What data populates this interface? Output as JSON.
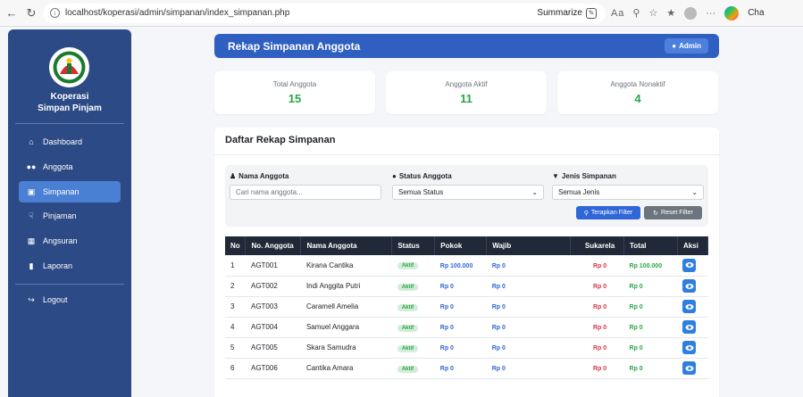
{
  "browser": {
    "url": "localhost/koperasi/admin/simpanan/index_simpanan.php",
    "summarize_label": "Summarize",
    "copilot_label": "Cha"
  },
  "sidebar": {
    "brand_line1": "Koperasi",
    "brand_line2": "Simpan Pinjam",
    "items": [
      {
        "label": "Dashboard",
        "icon": "home-icon"
      },
      {
        "label": "Anggota",
        "icon": "users-icon"
      },
      {
        "label": "Simpanan",
        "icon": "wallet-icon"
      },
      {
        "label": "Pinjaman",
        "icon": "hand-money-icon"
      },
      {
        "label": "Angsuran",
        "icon": "calendar-icon"
      },
      {
        "label": "Laporan",
        "icon": "file-icon"
      }
    ],
    "logout_label": "Logout",
    "active_item": "Simpanan"
  },
  "header": {
    "title": "Rekap Simpanan Anggota",
    "admin_label": "Admin"
  },
  "stats": [
    {
      "label": "Total Anggota",
      "value": "15"
    },
    {
      "label": "Anggota Aktif",
      "value": "11"
    },
    {
      "label": "Anggota Nonaktif",
      "value": "4"
    }
  ],
  "main": {
    "title": "Daftar Rekap Simpanan",
    "filter": {
      "name_label": "Nama Anggota",
      "name_placeholder": "Cari nama anggota...",
      "status_label": "Status Anggota",
      "status_value": "Semua Status",
      "type_label": "Jenis Simpanan",
      "type_value": "Semua Jenis",
      "apply_label": "Terapkan Filter",
      "reset_label": "Reset Filter"
    },
    "table": {
      "headers": [
        "No",
        "No. Anggota",
        "Nama Anggota",
        "Status",
        "Pokok",
        "Wajib",
        "Sukarela",
        "Total",
        "Aksi"
      ],
      "rows": [
        {
          "no": "1",
          "id": "AGT001",
          "name": "Kirana Cantika",
          "status": "Aktif",
          "pokok": "Rp 100.000",
          "wajib": "Rp 0",
          "sukarela": "Rp 0",
          "total": "Rp 100.000"
        },
        {
          "no": "2",
          "id": "AGT002",
          "name": "Indi Anggita Putri",
          "status": "Aktif",
          "pokok": "Rp 0",
          "wajib": "Rp 0",
          "sukarela": "Rp 0",
          "total": "Rp 0"
        },
        {
          "no": "3",
          "id": "AGT003",
          "name": "Caramell Amelia",
          "status": "Aktif",
          "pokok": "Rp 0",
          "wajib": "Rp 0",
          "sukarela": "Rp 0",
          "total": "Rp 0"
        },
        {
          "no": "4",
          "id": "AGT004",
          "name": "Samuel Anggara",
          "status": "Aktif",
          "pokok": "Rp 0",
          "wajib": "Rp 0",
          "sukarela": "Rp 0",
          "total": "Rp 0"
        },
        {
          "no": "5",
          "id": "AGT005",
          "name": "Skara Samudra",
          "status": "Aktif",
          "pokok": "Rp 0",
          "wajib": "Rp 0",
          "sukarela": "Rp 0",
          "total": "Rp 0"
        },
        {
          "no": "6",
          "id": "AGT006",
          "name": "Cantika Amara",
          "status": "Aktif",
          "pokok": "Rp 0",
          "wajib": "Rp 0",
          "sukarela": "Rp 0",
          "total": "Rp 0"
        }
      ]
    }
  },
  "colors": {
    "sidebar": "#2c4a86",
    "primary": "#2f5fc0",
    "success": "#28a745",
    "danger": "#dc3545"
  }
}
